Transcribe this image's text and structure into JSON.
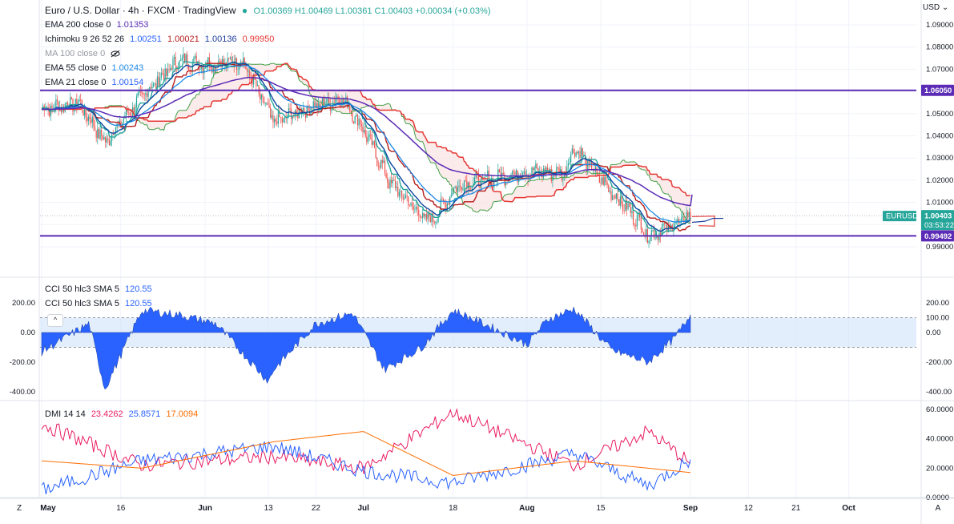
{
  "header": {
    "title": "Euro / U.S. Dollar · 4h · FXCM · TradingView",
    "ohlc": "O1.00369 H1.00469 L1.00361 C1.00403 +0.00034 (+0.03%)"
  },
  "indicators": {
    "ema200": {
      "label": "EMA 200 close 0",
      "value": "1.01353",
      "color": "#5b2bb5"
    },
    "ichimoku": {
      "label": "Ichimoku 9 26 52 26",
      "v1": "1.00251",
      "v2": "1.00021",
      "v3": "1.00136",
      "v4": "0.99950"
    },
    "ma100": {
      "label": "MA 100 close 0"
    },
    "ema55": {
      "label": "EMA 55 close 0",
      "value": "1.00243",
      "color": "#1e88e5"
    },
    "ema21": {
      "label": "EMA 21 close 0",
      "value": "1.00154",
      "color": "#2a2e39"
    }
  },
  "cci": {
    "label1": "CCI 50 hlc3 SMA 5",
    "value1": "120.55",
    "label2": "CCI 50 hlc3 SMA 5",
    "value2": "120.55",
    "collapse": "^"
  },
  "dmi": {
    "label": "DMI 14 14",
    "v1": "23.4262",
    "v2": "25.8571",
    "v3": "17.0094"
  },
  "currency": "USD ⌄",
  "price_axis": [
    "1.09000",
    "1.08000",
    "1.07000",
    "1.06000",
    "1.05000",
    "1.04000",
    "1.03000",
    "1.02000",
    "1.01000",
    "0.99000"
  ],
  "cci_axis": [
    "200.00",
    "0.00",
    "-200.00",
    "-400.00"
  ],
  "cci_axis_right": [
    "200.00",
    "100.00",
    "0.00",
    "-200.00",
    "-400.00"
  ],
  "dmi_axis": [
    "60.0000",
    "40.0000",
    "20.0000",
    "0.0000"
  ],
  "x_axis": [
    "May",
    "16",
    "Jun",
    "13",
    "22",
    "Jul",
    "18",
    "Aug",
    "15",
    "Sep",
    "12",
    "21",
    "Oct"
  ],
  "tags": {
    "line_top": "1.06050",
    "symbol": "EURUSD",
    "price": "1.00403",
    "countdown": "03:53:22",
    "line_bottom": "0.99492"
  },
  "footer": {
    "left": "Z",
    "right": "A"
  },
  "colors": {
    "up": "#26a69a",
    "down": "#ef5350",
    "hline": "#5b2bb5",
    "cci_fill": "#2962ff",
    "cci_band": "#cfe3f9",
    "dmi_plus": "#e91e63",
    "dmi_minus": "#2962ff",
    "adx": "#ff6d00"
  },
  "chart_data": {
    "type": "line",
    "instrument": "EURUSD",
    "timeframe": "4h",
    "x_range": [
      "May",
      "Oct"
    ],
    "price_ylim": [
      0.985,
      1.095
    ],
    "close_path": {
      "x": [
        "May 1",
        "May 8",
        "May 13",
        "May 20",
        "May 27",
        "Jun 1",
        "Jun 8",
        "Jun 14",
        "Jun 20",
        "Jun 27",
        "Jul 1",
        "Jul 6",
        "Jul 12",
        "Jul 14",
        "Jul 19",
        "Jul 26",
        "Aug 1",
        "Aug 8",
        "Aug 10",
        "Aug 15",
        "Aug 22",
        "Aug 24",
        "Aug 29",
        "Sep 1"
      ],
      "y": [
        1.052,
        1.055,
        1.037,
        1.058,
        1.074,
        1.072,
        1.074,
        1.046,
        1.052,
        1.057,
        1.043,
        1.019,
        1.004,
        1.002,
        1.018,
        1.021,
        1.024,
        1.023,
        1.035,
        1.02,
        1.002,
        0.995,
        1.0,
        1.004
      ]
    },
    "hlines": [
      1.0605,
      0.99492
    ],
    "cci": {
      "x": [
        "May 1",
        "May 10",
        "May 13",
        "May 20",
        "May 27",
        "Jun 3",
        "Jun 13",
        "Jun 14",
        "Jun 22",
        "Jun 29",
        "Jul 5",
        "Jul 12",
        "Jul 18",
        "Jul 25",
        "Aug 1",
        "Aug 5",
        "Aug 10",
        "Aug 17",
        "Aug 24",
        "Aug 29",
        "Sep 1"
      ],
      "y": [
        -130,
        60,
        -380,
        150,
        120,
        60,
        -330,
        -250,
        60,
        130,
        -250,
        -100,
        150,
        40,
        -80,
        90,
        160,
        -120,
        -200,
        -40,
        120.55
      ],
      "ylim": [
        -420,
        260
      ],
      "bands": [
        100,
        -100
      ]
    },
    "dmi": {
      "series": [
        {
          "name": "DMI+",
          "x": [
            "May 1",
            "May 20",
            "Jun 14",
            "Jul 1",
            "Jul 18",
            "Aug 10",
            "Aug 24",
            "Sep 1"
          ],
          "y": [
            50,
            22,
            28,
            20,
            58,
            22,
            45,
            23.4262
          ]
        },
        {
          "name": "DMI-",
          "x": [
            "May 1",
            "May 20",
            "Jun 14",
            "Jul 1",
            "Jul 18",
            "Aug 10",
            "Aug 24",
            "Sep 1"
          ],
          "y": [
            5,
            25,
            35,
            18,
            10,
            30,
            8,
            25.8571
          ]
        },
        {
          "name": "ADX",
          "x": [
            "May 1",
            "May 20",
            "Jun 14",
            "Jul 1",
            "Jul 18",
            "Aug 10",
            "Aug 24",
            "Sep 1"
          ],
          "y": [
            25,
            20,
            38,
            45,
            15,
            25,
            20,
            17.0094
          ]
        }
      ],
      "ylim": [
        0,
        60
      ]
    }
  }
}
